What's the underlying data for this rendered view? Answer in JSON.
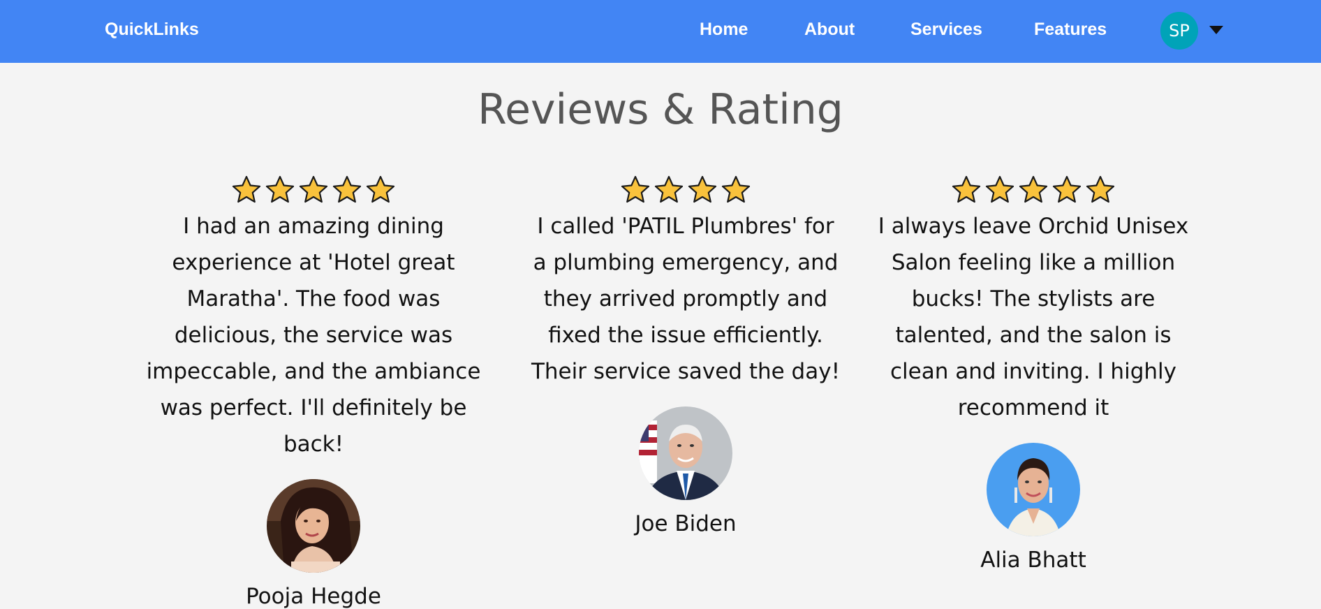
{
  "navbar": {
    "brand": "QuickLinks",
    "links": [
      "Home",
      "About",
      "Services",
      "Features"
    ],
    "user_initials": "SP"
  },
  "page": {
    "title": "Reviews & Rating"
  },
  "colors": {
    "nav_bg": "#4285f4",
    "avatar_bg": "#00a3b8",
    "star": "#f9c23c",
    "page_bg": "#f4f4f4"
  },
  "reviews": [
    {
      "stars": 5,
      "text": "I had an amazing dining experience at 'Hotel great Maratha'. The food was delicious, the service was impeccable, and the ambiance was perfect. I'll definitely be back!",
      "name": "Pooja Hegde",
      "photo": "reviewer-photo"
    },
    {
      "stars": 4,
      "text": "I called 'PATIL Plumbres' for a plumbing emergency, and they arrived promptly and fixed the issue efficiently. Their service saved the day!",
      "name": "Joe Biden",
      "photo": "reviewer-photo"
    },
    {
      "stars": 5,
      "text": "I always leave Orchid Unisex Salon feeling like a million bucks! The stylists are talented, and the salon is clean and inviting. I highly recommend it",
      "name": "Alia Bhatt",
      "photo": "reviewer-photo"
    }
  ]
}
